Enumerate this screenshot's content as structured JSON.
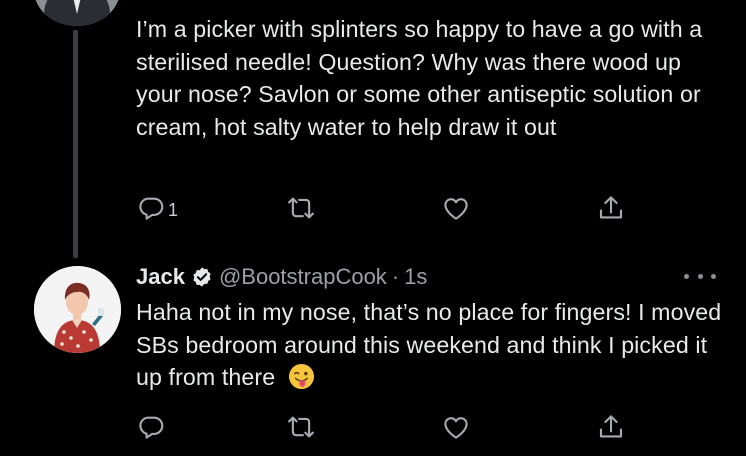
{
  "tweet1": {
    "text": "I’m a picker with splinters so happy to have a go with a sterilised needle! Question? Why was there wood up your nose? Savlon or some other antiseptic solution or cream, hot salty water to help draw it out",
    "reply_count": "1",
    "icons": [
      "reply-icon",
      "retweet-icon",
      "like-icon",
      "share-icon"
    ]
  },
  "tweet2": {
    "name": "Jack",
    "handle": "@BootstrapCook",
    "separator": "·",
    "time": "1s",
    "text": "Haha not in my nose, that’s no place for fingers! I moved SBs bedroom around this weekend and think I picked it up from there",
    "emoji": "tongue-out-emoji",
    "icons": [
      "reply-icon",
      "retweet-icon",
      "like-icon",
      "share-icon",
      "more-options-icon",
      "verified-badge-icon"
    ]
  },
  "colors": {
    "background": "#000000",
    "text": "#e7e9ea",
    "secondary_text": "#9aa0a6",
    "thread_line": "#3c3e41"
  }
}
